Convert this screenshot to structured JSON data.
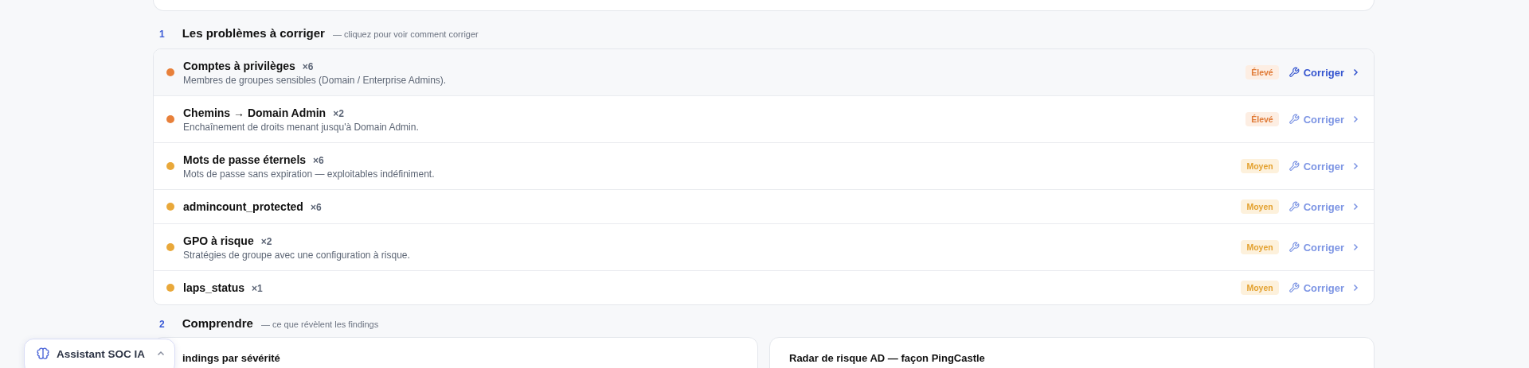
{
  "sections": [
    {
      "number": "1",
      "title": "Les problèmes à corriger",
      "hint": "— cliquez pour voir comment corriger"
    },
    {
      "number": "2",
      "title": "Comprendre",
      "hint": "— ce que révèlent les findings"
    }
  ],
  "problems": [
    {
      "title": "Comptes à privilèges",
      "count": "×6",
      "description": "Membres de groupes sensibles (Domain / Enterprise Admins).",
      "severity": "Élevé",
      "kind": "high",
      "color": "#e8803a",
      "action": "Corriger",
      "selected": true
    },
    {
      "title": "Chemins → Domain Admin",
      "count": "×2",
      "description": "Enchaînement de droits menant jusqu'à Domain Admin.",
      "severity": "Élevé",
      "kind": "high",
      "color": "#e8803a",
      "action": "Corriger",
      "selected": false
    },
    {
      "title": "Mots de passe éternels",
      "count": "×6",
      "description": "Mots de passe sans expiration — exploitables indéfiniment.",
      "severity": "Moyen",
      "kind": "medium",
      "color": "#e9a83a",
      "action": "Corriger",
      "selected": false
    },
    {
      "title": "admincount_protected",
      "count": "×6",
      "severity": "Moyen",
      "kind": "medium",
      "color": "#e9a83a",
      "action": "Corriger",
      "selected": false
    },
    {
      "title": "GPO à risque",
      "count": "×2",
      "description": "Stratégies de groupe avec une configuration à risque.",
      "severity": "Moyen",
      "kind": "medium",
      "color": "#e9a83a",
      "action": "Corriger",
      "selected": false
    },
    {
      "title": "laps_status",
      "count": "×1",
      "severity": "Moyen",
      "kind": "medium",
      "color": "#e9a83a",
      "action": "Corriger",
      "selected": false
    }
  ],
  "cards": [
    {
      "title": "indings par sévérité"
    },
    {
      "title": "Radar de risque AD — façon PingCastle"
    }
  ],
  "assistant": {
    "label": "Assistant SOC IA",
    "expanded": false
  }
}
